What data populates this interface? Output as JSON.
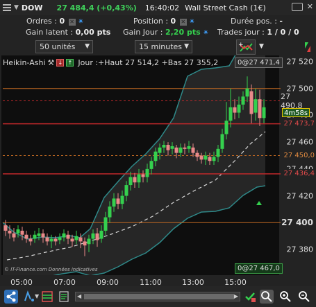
{
  "titlebar": {
    "symbol": "DOW",
    "price": "27 484,4 (+0,43%)",
    "time": "16:40:02",
    "market": "Wall Street Cash (1€)"
  },
  "info": {
    "orders_label": "Ordres :",
    "orders_value": "0",
    "position_label": "Position :",
    "position_value": "0",
    "duration_label": "Durée pos. :",
    "duration_value": "-",
    "latent_label": "Gain latent :",
    "latent_value": "0,00 pts",
    "day_gain_label": "Gain Jour :",
    "day_gain_value": "2,20 pts",
    "trades_label": "Trades jour :",
    "trades_value": "1 / 0 / 0"
  },
  "toolbar": {
    "units_select": "50 unités",
    "interval_select": "15 minutes"
  },
  "chart_header": {
    "indicator": "Heikin-Ashi",
    "day_info": "Jour :+Haut 27 514,2 +Bas 27 355,2"
  },
  "tags": {
    "top_price": "0@27 471,4",
    "bottom_price": "0@27 467,0",
    "countdown": "4m58s",
    "price_right": "27 473,7",
    "level1": "27 450,0",
    "level2": "27 436,4"
  },
  "credits": "© IT-Finance.com  Données indicatives",
  "chart_data": {
    "type": "candlestick",
    "x_ticks": [
      "05:00",
      "07:00",
      "09:00",
      "11:00",
      "13:00",
      "15:00"
    ],
    "y_ticks": [
      "27 520",
      "27 500",
      "27 490,8",
      "27 480",
      "27 460",
      "27 440",
      "27 420",
      "27 400",
      "27 380"
    ],
    "ylim": [
      27370,
      27526
    ]
  },
  "colors": {
    "bull": "#35d04e",
    "bear": "#e98a8a",
    "band": "#2a6a6a",
    "resistance": "#c0282a",
    "level": "#c46a22"
  }
}
